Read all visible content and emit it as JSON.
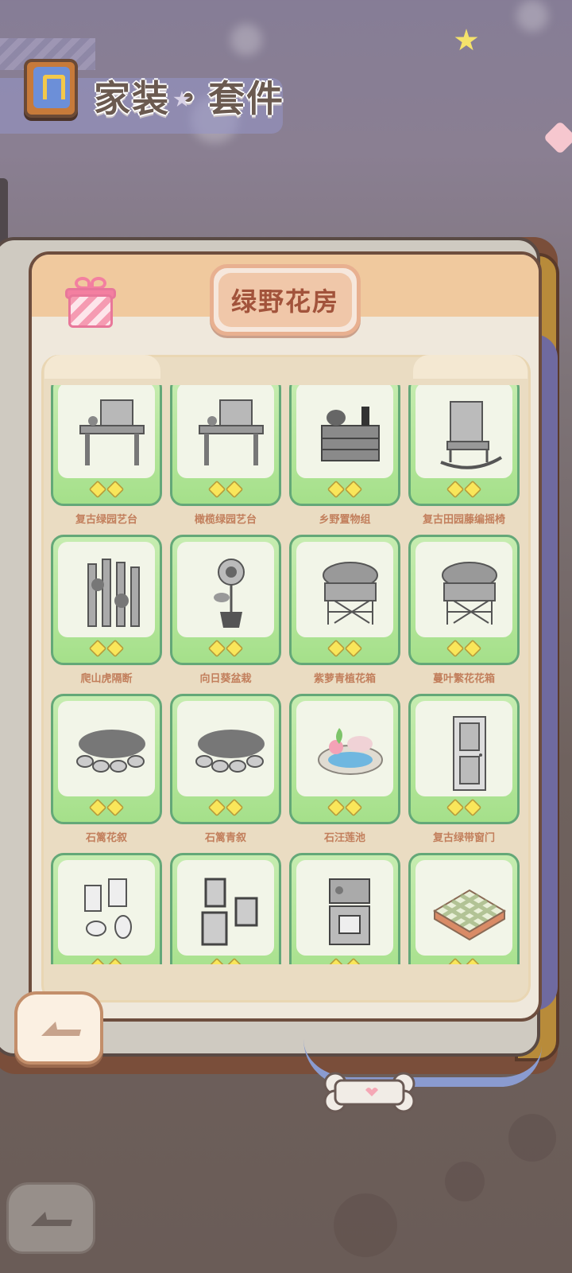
{
  "header": {
    "title": "家装・套件",
    "icon": "furniture-book-icon"
  },
  "suite": {
    "title": "绿野花房",
    "gift_icon": "gift-icon"
  },
  "items": [
    {
      "name": "复古绿园艺台",
      "icon": "potting-bench-icon",
      "stars": 2
    },
    {
      "name": "橄榄绿园艺台",
      "icon": "potting-bench-icon",
      "stars": 2
    },
    {
      "name": "乡野置物组",
      "icon": "storage-shelf-icon",
      "stars": 2
    },
    {
      "name": "复古田园藤编摇椅",
      "icon": "rocking-chair-icon",
      "stars": 2
    },
    {
      "name": "爬山虎隔断",
      "icon": "vine-fence-icon",
      "stars": 2
    },
    {
      "name": "向日葵盆栽",
      "icon": "sunflower-pot-icon",
      "stars": 2
    },
    {
      "name": "紫萝青植花箱",
      "icon": "planter-box-icon",
      "stars": 2
    },
    {
      "name": "蔓叶繁花花箱",
      "icon": "planter-box-icon",
      "stars": 2
    },
    {
      "name": "石篱花叙",
      "icon": "stone-flowerbed-icon",
      "stars": 2
    },
    {
      "name": "石篱青叙",
      "icon": "stone-flowerbed-icon",
      "stars": 2
    },
    {
      "name": "石汪莲池",
      "icon": "lotus-pond-icon",
      "stars": 2
    },
    {
      "name": "复古绿带窗门",
      "icon": "door-icon",
      "stars": 2
    },
    {
      "name": "",
      "icon": "wall-frames-icon",
      "stars": 2
    },
    {
      "name": "",
      "icon": "picture-frames-icon",
      "stars": 2
    },
    {
      "name": "",
      "icon": "shelf-cabinet-icon",
      "stars": 2
    },
    {
      "name": "",
      "icon": "checkered-floor-icon",
      "stars": 2
    }
  ],
  "buttons": {
    "back": "back-arrow-icon",
    "bottom_back": "back-arrow-icon"
  },
  "colors": {
    "card_border": "#64a878",
    "card_fill": "#a5e08a",
    "title_text": "#a2533b",
    "item_text": "#c27f5c"
  }
}
